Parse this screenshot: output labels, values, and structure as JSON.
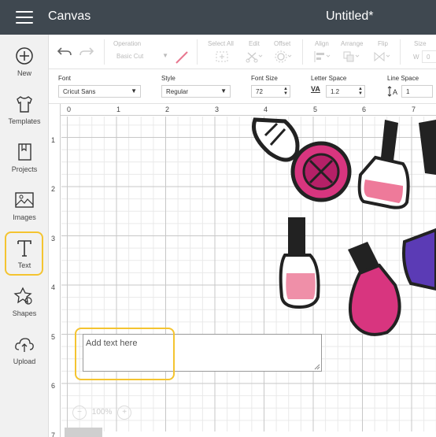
{
  "header": {
    "app_title": "Canvas",
    "doc_title": "Untitled*",
    "bg_color": "#3f4850"
  },
  "sidebar": {
    "items": [
      {
        "label": "New",
        "icon": "plus-circle-icon"
      },
      {
        "label": "Templates",
        "icon": "shirt-icon"
      },
      {
        "label": "Projects",
        "icon": "bookmark-book-icon"
      },
      {
        "label": "Images",
        "icon": "image-icon"
      },
      {
        "label": "Text",
        "icon": "text-t-icon"
      },
      {
        "label": "Shapes",
        "icon": "shapes-icon"
      },
      {
        "label": "Upload",
        "icon": "cloud-upload-icon"
      }
    ]
  },
  "toolbar": {
    "operation_label": "Operation",
    "operation_value": "Basic Cut",
    "select_all_label": "Select All",
    "edit_label": "Edit",
    "offset_label": "Offset",
    "align_label": "Align",
    "arrange_label": "Arrange",
    "flip_label": "Flip",
    "size_label": "Size",
    "size_w": "W",
    "size_w_value": "0"
  },
  "text_toolbar": {
    "font_label": "Font",
    "font_value": "Cricut Sans",
    "style_label": "Style",
    "style_value": "Regular",
    "font_size_label": "Font Size",
    "font_size_value": "72",
    "letter_space_label": "Letter Space",
    "letter_space_icon_text": "VA",
    "letter_space_value": "1.2",
    "line_space_label": "Line Space",
    "line_space_value": "1"
  },
  "canvas": {
    "ruler_top": [
      "0",
      "1",
      "2",
      "3",
      "4",
      "5",
      "6",
      "7"
    ],
    "ruler_left": [
      "1",
      "2",
      "3",
      "4",
      "5",
      "6",
      "7"
    ],
    "textbox_placeholder": "Add text here",
    "zoom": "100%",
    "highlight_color": "#f4c430"
  }
}
